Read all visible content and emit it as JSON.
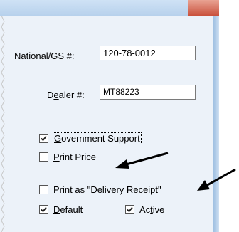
{
  "form": {
    "national_label_pre": "",
    "national_label_acc": "N",
    "national_label_post": "ational/GS #:",
    "national_value": "120-78-0012",
    "dealer_label_pre": "D",
    "dealer_label_acc": "e",
    "dealer_label_post": "aler #:",
    "dealer_value": "MT88223"
  },
  "checkboxes": {
    "government_support": {
      "acc": "G",
      "rest": "overnment Support",
      "checked": true
    },
    "print_price": {
      "acc": "P",
      "rest": "rint Price",
      "checked": false
    },
    "delivery_receipt": {
      "pre": "Print as \"",
      "acc": "D",
      "post": "elivery Receipt\"",
      "checked": false
    },
    "default": {
      "acc": "D",
      "rest": "efault",
      "checked": true
    },
    "active": {
      "pre": "Ac",
      "acc": "t",
      "post": "ive",
      "checked": true
    }
  }
}
